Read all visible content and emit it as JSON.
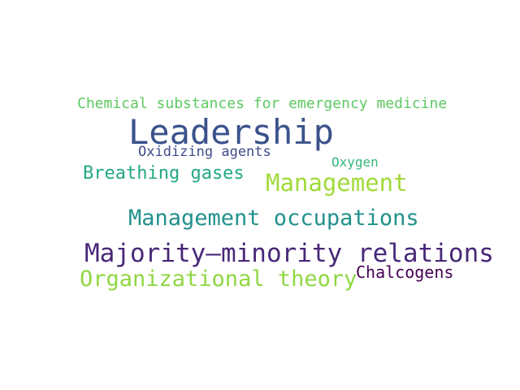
{
  "words": [
    {
      "text": "Chemical substances for emergency medicine",
      "color": "#5ec962"
    },
    {
      "text": "Leadership",
      "color": "#3b528b"
    },
    {
      "text": "Oxidizing agents",
      "color": "#3e4a89"
    },
    {
      "text": "Oxygen",
      "color": "#35b779"
    },
    {
      "text": "Breathing gases",
      "color": "#22a884"
    },
    {
      "text": "Management",
      "color": "#a0da39"
    },
    {
      "text": "Management occupations",
      "color": "#21918c"
    },
    {
      "text": "Majority–minority relations",
      "color": "#482878"
    },
    {
      "text": "Organizational theory",
      "color": "#90d743"
    },
    {
      "text": "Chalcogens",
      "color": "#440154"
    }
  ]
}
